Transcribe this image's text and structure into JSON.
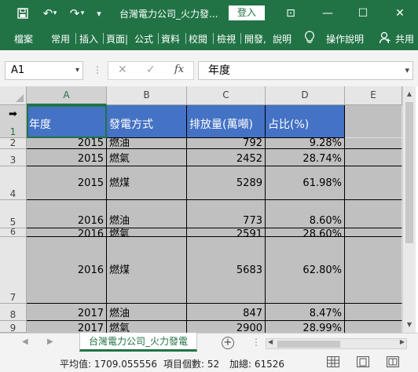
{
  "titlebar": {
    "title": "台灣電力公司_火力發...",
    "login_label": "登入",
    "save_icon": "floppy-icon",
    "undo_glyph": "↶",
    "redo_glyph": "↷",
    "customize_glyph": "▾",
    "dropdown_glyph": "▾",
    "ribbon_display_glyph": "⊡",
    "minimize_glyph": "—",
    "maximize_glyph": "☐",
    "close_glyph": "✕"
  },
  "ribbon": {
    "tabs": [
      "檔案",
      "常用",
      "插入",
      "頁面|",
      "公式",
      "資料",
      "校閱",
      "檢視",
      "開發,",
      "說明"
    ],
    "tell_me": "操作說明",
    "share": "共用",
    "lightbulb_glyph": "💡",
    "person_glyph": "👤"
  },
  "formula_bar": {
    "name_box": "A1",
    "formula": "年度",
    "cancel_glyph": "✕",
    "enter_glyph": "✓",
    "fx_label": "fx",
    "dots": "⋮",
    "dropdown_glyph": "▾"
  },
  "columns": [
    "A",
    "B",
    "C",
    "D",
    "E"
  ],
  "rows": [
    {
      "num": "1",
      "cells": [
        "年度",
        "發電方式",
        "排放量(萬噸)",
        "占比(%)"
      ]
    },
    {
      "num": "2",
      "cells": [
        "2015",
        "燃油",
        "792",
        "9.28%"
      ]
    },
    {
      "num": "3",
      "cells": [
        "2015",
        "燃氣",
        "2452",
        "28.74%"
      ]
    },
    {
      "num": "4",
      "cells": [
        "2015",
        "燃煤",
        "5289",
        "61.98%"
      ]
    },
    {
      "num": "5",
      "cells": [
        "2016",
        "燃油",
        "773",
        "8.60%"
      ]
    },
    {
      "num": "6",
      "cells": [
        "2016",
        "燃氣",
        "2591",
        "28.60%"
      ]
    },
    {
      "num": "7",
      "cells": [
        "2016",
        "燃煤",
        "5683",
        "62.80%"
      ]
    },
    {
      "num": "8",
      "cells": [
        "2017",
        "燃油",
        "847",
        "8.47%"
      ]
    },
    {
      "num": "9",
      "cells": [
        "2017",
        "燃氣",
        "2900",
        "28.99%"
      ]
    }
  ],
  "sheet": {
    "tab_label": "台灣電力公司_火力發電",
    "add_glyph": "+",
    "prev_glyph": "◀",
    "next_glyph": "▶",
    "more_glyph": "⋮"
  },
  "statusbar": {
    "average": "平均值: 1709.055556",
    "count": "項目個數: 52",
    "sum": "加總: 61526"
  },
  "colors": {
    "accent": "#217346",
    "header_fill": "#4472c4",
    "data_fill": "#c0c0c0"
  }
}
